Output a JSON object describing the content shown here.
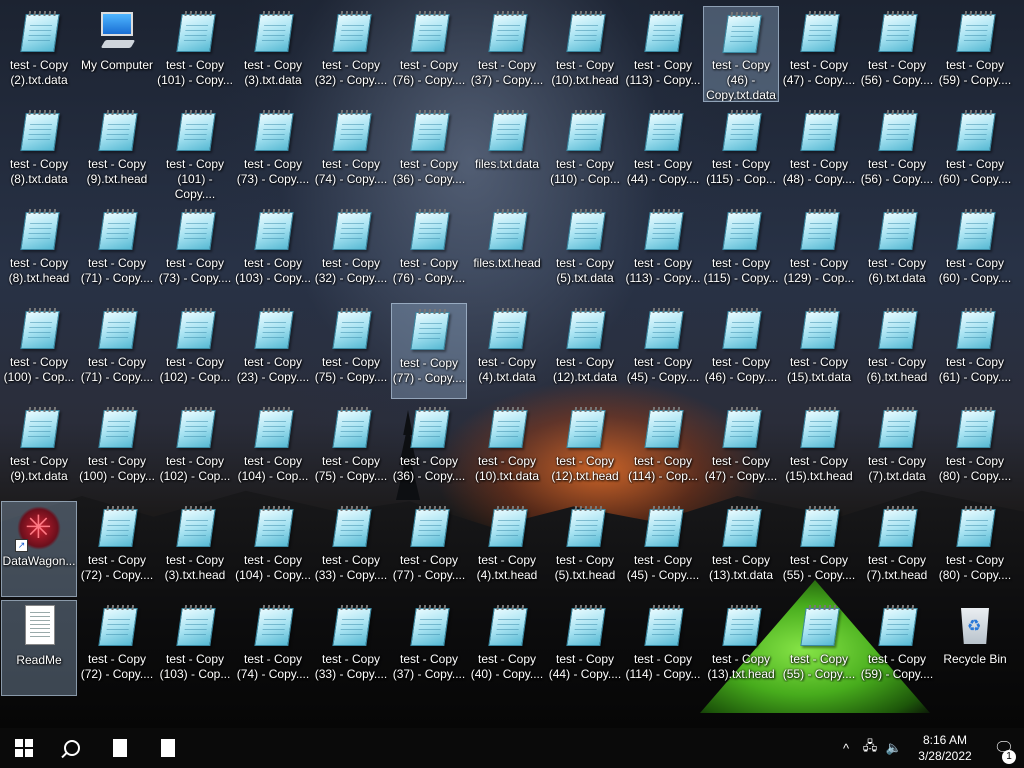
{
  "desktop": {
    "icons": [
      {
        "label": "test - Copy (2).txt.data",
        "type": "note",
        "col": 0,
        "row": 0
      },
      {
        "label": "My Computer",
        "type": "computer",
        "col": 1,
        "row": 0
      },
      {
        "label": "test - Copy (101) - Copy...",
        "type": "note",
        "col": 2,
        "row": 0
      },
      {
        "label": "test - Copy (3).txt.data",
        "type": "note",
        "col": 3,
        "row": 0
      },
      {
        "label": "test - Copy (32) - Copy....",
        "type": "note",
        "col": 4,
        "row": 0
      },
      {
        "label": "test - Copy (76) - Copy....",
        "type": "note",
        "col": 5,
        "row": 0
      },
      {
        "label": "test - Copy (37) - Copy....",
        "type": "note",
        "col": 6,
        "row": 0
      },
      {
        "label": "test - Copy (10).txt.head",
        "type": "note",
        "col": 7,
        "row": 0
      },
      {
        "label": "test - Copy (113) - Copy...",
        "type": "note",
        "col": 8,
        "row": 0
      },
      {
        "label": "test - Copy (46) - Copy.txt.data",
        "type": "note",
        "col": 9,
        "row": 0,
        "selected": true
      },
      {
        "label": "test - Copy (47) - Copy....",
        "type": "note",
        "col": 10,
        "row": 0
      },
      {
        "label": "test - Copy (56) - Copy....",
        "type": "note",
        "col": 11,
        "row": 0
      },
      {
        "label": "test - Copy (59) - Copy....",
        "type": "note",
        "col": 12,
        "row": 0
      },
      {
        "label": "test - Copy (8).txt.data",
        "type": "note",
        "col": 0,
        "row": 1
      },
      {
        "label": "test - Copy (9).txt.head",
        "type": "note",
        "col": 1,
        "row": 1
      },
      {
        "label": "test - Copy (101) - Copy....",
        "type": "note",
        "col": 2,
        "row": 1
      },
      {
        "label": "test - Copy (73) - Copy....",
        "type": "note",
        "col": 3,
        "row": 1
      },
      {
        "label": "test - Copy (74) - Copy....",
        "type": "note",
        "col": 4,
        "row": 1
      },
      {
        "label": "test - Copy (36) - Copy....",
        "type": "note",
        "col": 5,
        "row": 1
      },
      {
        "label": "files.txt.data",
        "type": "note",
        "col": 6,
        "row": 1
      },
      {
        "label": "test - Copy (110) - Cop...",
        "type": "note",
        "col": 7,
        "row": 1
      },
      {
        "label": "test - Copy (44) - Copy....",
        "type": "note",
        "col": 8,
        "row": 1
      },
      {
        "label": "test - Copy (115) - Cop...",
        "type": "note",
        "col": 9,
        "row": 1
      },
      {
        "label": "test - Copy (48) - Copy....",
        "type": "note",
        "col": 10,
        "row": 1
      },
      {
        "label": "test - Copy (56) - Copy....",
        "type": "note",
        "col": 11,
        "row": 1
      },
      {
        "label": "test - Copy (60) - Copy....",
        "type": "note",
        "col": 12,
        "row": 1
      },
      {
        "label": "test - Copy (8).txt.head",
        "type": "note",
        "col": 0,
        "row": 2
      },
      {
        "label": "test - Copy (71) - Copy....",
        "type": "note",
        "col": 1,
        "row": 2
      },
      {
        "label": "test - Copy (73) - Copy....",
        "type": "note",
        "col": 2,
        "row": 2
      },
      {
        "label": "test - Copy (103) - Copy...",
        "type": "note",
        "col": 3,
        "row": 2
      },
      {
        "label": "test - Copy (32) - Copy....",
        "type": "note",
        "col": 4,
        "row": 2
      },
      {
        "label": "test - Copy (76) - Copy....",
        "type": "note",
        "col": 5,
        "row": 2
      },
      {
        "label": "files.txt.head",
        "type": "note",
        "col": 6,
        "row": 2
      },
      {
        "label": "test - Copy (5).txt.data",
        "type": "note",
        "col": 7,
        "row": 2
      },
      {
        "label": "test - Copy (113) - Copy...",
        "type": "note",
        "col": 8,
        "row": 2
      },
      {
        "label": "test - Copy (115) - Copy...",
        "type": "note",
        "col": 9,
        "row": 2
      },
      {
        "label": "test - Copy (129) - Cop...",
        "type": "note",
        "col": 10,
        "row": 2
      },
      {
        "label": "test - Copy (6).txt.data",
        "type": "note",
        "col": 11,
        "row": 2
      },
      {
        "label": "test - Copy (60) - Copy....",
        "type": "note",
        "col": 12,
        "row": 2
      },
      {
        "label": "test - Copy (100) - Cop...",
        "type": "note",
        "col": 0,
        "row": 3
      },
      {
        "label": "test - Copy (71) - Copy....",
        "type": "note",
        "col": 1,
        "row": 3
      },
      {
        "label": "test - Copy (102) - Cop...",
        "type": "note",
        "col": 2,
        "row": 3
      },
      {
        "label": "test - Copy (23) - Copy....",
        "type": "note",
        "col": 3,
        "row": 3
      },
      {
        "label": "test - Copy (75) - Copy....",
        "type": "note",
        "col": 4,
        "row": 3
      },
      {
        "label": "test - Copy (77) - Copy....",
        "type": "note",
        "col": 5,
        "row": 3,
        "selected": true
      },
      {
        "label": "test - Copy (4).txt.data",
        "type": "note",
        "col": 6,
        "row": 3
      },
      {
        "label": "test - Copy (12).txt.data",
        "type": "note",
        "col": 7,
        "row": 3
      },
      {
        "label": "test - Copy (45) - Copy....",
        "type": "note",
        "col": 8,
        "row": 3
      },
      {
        "label": "test - Copy (46) - Copy....",
        "type": "note",
        "col": 9,
        "row": 3
      },
      {
        "label": "test - Copy (15).txt.data",
        "type": "note",
        "col": 10,
        "row": 3
      },
      {
        "label": "test - Copy (6).txt.head",
        "type": "note",
        "col": 11,
        "row": 3
      },
      {
        "label": "test - Copy (61) - Copy....",
        "type": "note",
        "col": 12,
        "row": 3
      },
      {
        "label": "test - Copy (9).txt.data",
        "type": "note",
        "col": 0,
        "row": 4
      },
      {
        "label": "test - Copy (100) - Copy...",
        "type": "note",
        "col": 1,
        "row": 4
      },
      {
        "label": "test - Copy (102) - Cop...",
        "type": "note",
        "col": 2,
        "row": 4
      },
      {
        "label": "test - Copy (104) - Cop...",
        "type": "note",
        "col": 3,
        "row": 4
      },
      {
        "label": "test - Copy (75) - Copy....",
        "type": "note",
        "col": 4,
        "row": 4
      },
      {
        "label": "test - Copy (36) - Copy....",
        "type": "note",
        "col": 5,
        "row": 4
      },
      {
        "label": "test - Copy (10).txt.data",
        "type": "note",
        "col": 6,
        "row": 4
      },
      {
        "label": "test - Copy (12).txt.head",
        "type": "note",
        "col": 7,
        "row": 4
      },
      {
        "label": "test - Copy (114) - Cop...",
        "type": "note",
        "col": 8,
        "row": 4
      },
      {
        "label": "test - Copy (47) - Copy....",
        "type": "note",
        "col": 9,
        "row": 4
      },
      {
        "label": "test - Copy (15).txt.head",
        "type": "note",
        "col": 10,
        "row": 4
      },
      {
        "label": "test - Copy (7).txt.data",
        "type": "note",
        "col": 11,
        "row": 4
      },
      {
        "label": "test - Copy (80) - Copy....",
        "type": "note",
        "col": 12,
        "row": 4
      },
      {
        "label": "DataWagon...",
        "type": "datawagon",
        "col": 0,
        "row": 5,
        "selected": true
      },
      {
        "label": "test - Copy (72) - Copy....",
        "type": "note",
        "col": 1,
        "row": 5
      },
      {
        "label": "test - Copy (3).txt.head",
        "type": "note",
        "col": 2,
        "row": 5
      },
      {
        "label": "test - Copy (104) - Copy...",
        "type": "note",
        "col": 3,
        "row": 5
      },
      {
        "label": "test - Copy (33) - Copy....",
        "type": "note",
        "col": 4,
        "row": 5
      },
      {
        "label": "test - Copy (77) - Copy....",
        "type": "note",
        "col": 5,
        "row": 5
      },
      {
        "label": "test - Copy (4).txt.head",
        "type": "note",
        "col": 6,
        "row": 5
      },
      {
        "label": "test - Copy (5).txt.head",
        "type": "note",
        "col": 7,
        "row": 5
      },
      {
        "label": "test - Copy (45) - Copy....",
        "type": "note",
        "col": 8,
        "row": 5
      },
      {
        "label": "test - Copy (13).txt.data",
        "type": "note",
        "col": 9,
        "row": 5
      },
      {
        "label": "test - Copy (55) - Copy....",
        "type": "note",
        "col": 10,
        "row": 5
      },
      {
        "label": "test - Copy (7).txt.head",
        "type": "note",
        "col": 11,
        "row": 5
      },
      {
        "label": "test - Copy (80) - Copy....",
        "type": "note",
        "col": 12,
        "row": 5
      },
      {
        "label": "ReadMe",
        "type": "document",
        "col": 0,
        "row": 6,
        "selected": true
      },
      {
        "label": "test - Copy (72) - Copy....",
        "type": "note",
        "col": 1,
        "row": 6
      },
      {
        "label": "test - Copy (103) - Cop...",
        "type": "note",
        "col": 2,
        "row": 6
      },
      {
        "label": "test - Copy (74) - Copy....",
        "type": "note",
        "col": 3,
        "row": 6
      },
      {
        "label": "test - Copy (33) - Copy....",
        "type": "note",
        "col": 4,
        "row": 6
      },
      {
        "label": "test - Copy (37) - Copy....",
        "type": "note",
        "col": 5,
        "row": 6
      },
      {
        "label": "test - Copy (40) - Copy....",
        "type": "note",
        "col": 6,
        "row": 6
      },
      {
        "label": "test - Copy (44) - Copy....",
        "type": "note",
        "col": 7,
        "row": 6
      },
      {
        "label": "test - Copy (114) - Copy...",
        "type": "note",
        "col": 8,
        "row": 6
      },
      {
        "label": "test - Copy (13).txt.head",
        "type": "note",
        "col": 9,
        "row": 6
      },
      {
        "label": "test - Copy (55) - Copy....",
        "type": "note",
        "col": 10,
        "row": 6
      },
      {
        "label": "test - Copy (59) - Copy....",
        "type": "note",
        "col": 11,
        "row": 6
      },
      {
        "label": "Recycle Bin",
        "type": "recycle",
        "col": 12,
        "row": 6
      }
    ]
  },
  "taskbar": {
    "start_icon": "windows-start-icon",
    "search_icon": "search-icon",
    "pinned": [
      {
        "icon": "file-icon"
      },
      {
        "icon": "file-icon"
      }
    ],
    "tray": {
      "chevron": "^",
      "network_icon": "network-icon",
      "volume_icon": "volume-icon",
      "time": "8:16 AM",
      "date": "3/28/2022",
      "notification_count": "1"
    }
  }
}
